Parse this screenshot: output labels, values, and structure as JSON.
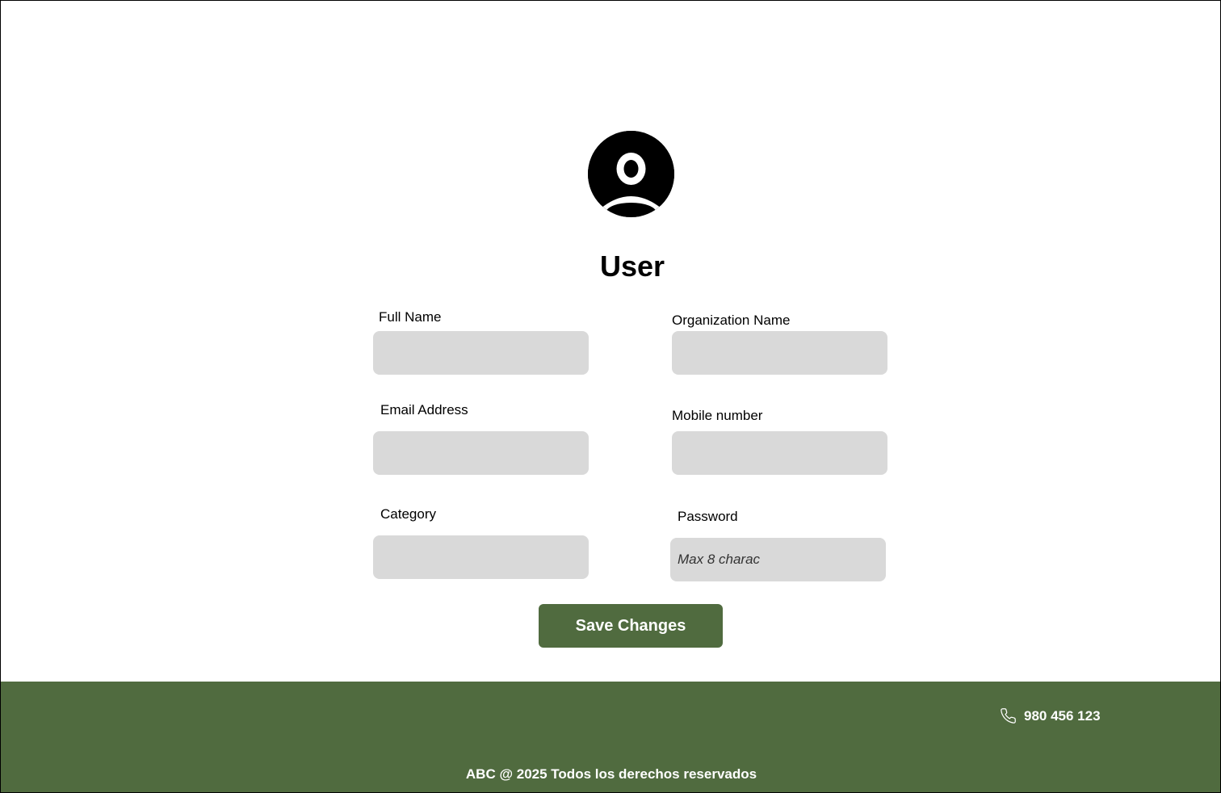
{
  "profile": {
    "title": "User",
    "avatar_icon": "user-avatar-icon"
  },
  "form": {
    "full_name": {
      "label": "Full Name",
      "value": "",
      "placeholder": ""
    },
    "organization_name": {
      "label": "Organization Name",
      "value": "",
      "placeholder": ""
    },
    "email_address": {
      "label": "Email Address",
      "value": "",
      "placeholder": ""
    },
    "mobile_number": {
      "label": "Mobile number",
      "value": "",
      "placeholder": ""
    },
    "category": {
      "label": "Category",
      "value": "",
      "placeholder": ""
    },
    "password": {
      "label": "Password",
      "value": "",
      "placeholder": "Max 8 charac"
    },
    "save_label": "Save Changes"
  },
  "footer": {
    "phone": "980 456 123",
    "phone_icon": "phone-icon",
    "copyright": "ABC @ 2025 Todos los derechos reservados"
  },
  "colors": {
    "brand_green": "#506b3f",
    "field_bg": "#d9d9d9"
  }
}
